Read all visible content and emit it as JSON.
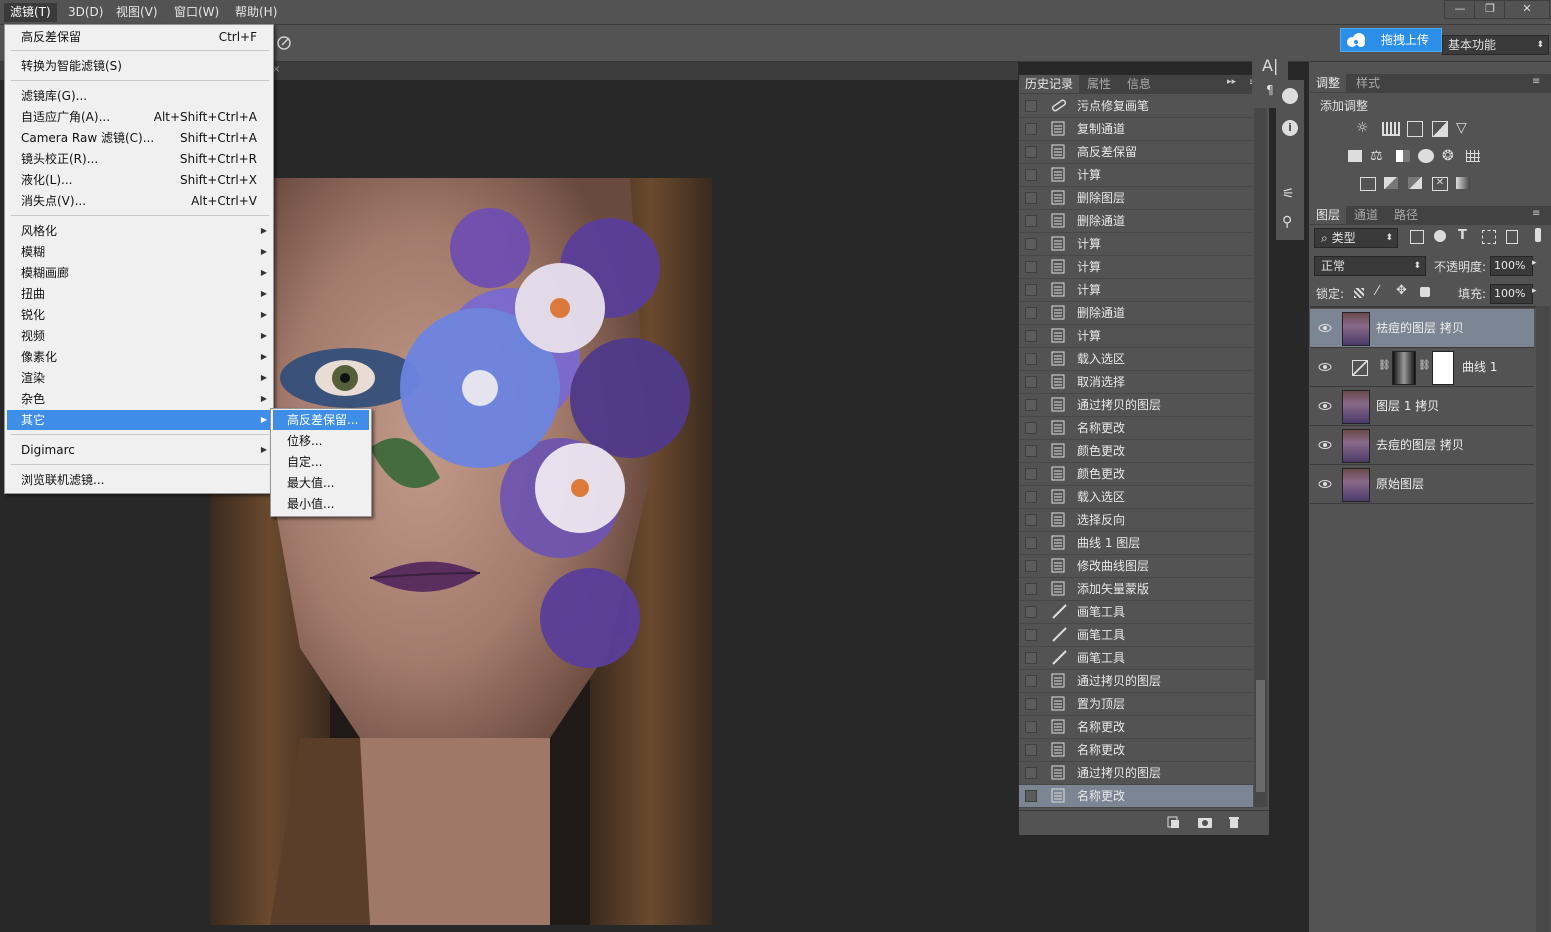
{
  "menubar": {
    "items": [
      "滤镜(T)",
      "3D(D)",
      "视图(V)",
      "窗口(W)",
      "帮助(H)"
    ],
    "window_buttons": [
      "—",
      "❐",
      "✕"
    ]
  },
  "optbar": {
    "upload_label": "拖拽上传",
    "workspace": "基本功能"
  },
  "filter_menu": {
    "last_filter": {
      "label": "高反差保留",
      "shortcut": "Ctrl+F"
    },
    "convert_smart": "转换为智能滤镜(S)",
    "group2": [
      {
        "label": "滤镜库(G)...",
        "shortcut": ""
      },
      {
        "label": "自适应广角(A)...",
        "shortcut": "Alt+Shift+Ctrl+A"
      },
      {
        "label": "Camera Raw 滤镜(C)...",
        "shortcut": "Shift+Ctrl+A"
      },
      {
        "label": "镜头校正(R)...",
        "shortcut": "Shift+Ctrl+R"
      },
      {
        "label": "液化(L)...",
        "shortcut": "Shift+Ctrl+X"
      },
      {
        "label": "消失点(V)...",
        "shortcut": "Alt+Ctrl+V"
      }
    ],
    "submenus": [
      "风格化",
      "模糊",
      "模糊画廊",
      "扭曲",
      "锐化",
      "视频",
      "像素化",
      "渲染",
      "杂色",
      "其它"
    ],
    "digimarc": "Digimarc",
    "browse_online": "浏览联机滤镜..."
  },
  "other_submenu": [
    "高反差保留...",
    "位移...",
    "自定...",
    "最大值...",
    "最小值..."
  ],
  "history_panel": {
    "tabs": [
      "历史记录",
      "属性",
      "信息"
    ],
    "items": [
      {
        "label": "污点修复画笔",
        "icon": "healing-brush-icon"
      },
      {
        "label": "复制通道",
        "icon": "document-icon"
      },
      {
        "label": "高反差保留",
        "icon": "document-icon"
      },
      {
        "label": "计算",
        "icon": "document-icon"
      },
      {
        "label": "删除图层",
        "icon": "document-icon"
      },
      {
        "label": "删除通道",
        "icon": "document-icon"
      },
      {
        "label": "计算",
        "icon": "document-icon"
      },
      {
        "label": "计算",
        "icon": "document-icon"
      },
      {
        "label": "计算",
        "icon": "document-icon"
      },
      {
        "label": "删除通道",
        "icon": "document-icon"
      },
      {
        "label": "计算",
        "icon": "document-icon"
      },
      {
        "label": "载入选区",
        "icon": "document-icon"
      },
      {
        "label": "取消选择",
        "icon": "document-icon"
      },
      {
        "label": "通过拷贝的图层",
        "icon": "document-icon"
      },
      {
        "label": "名称更改",
        "icon": "document-icon"
      },
      {
        "label": "颜色更改",
        "icon": "document-icon"
      },
      {
        "label": "颜色更改",
        "icon": "document-icon"
      },
      {
        "label": "载入选区",
        "icon": "document-icon"
      },
      {
        "label": "选择反向",
        "icon": "document-icon"
      },
      {
        "label": "曲线 1 图层",
        "icon": "document-icon"
      },
      {
        "label": "修改曲线图层",
        "icon": "document-icon"
      },
      {
        "label": "添加矢量蒙版",
        "icon": "document-icon"
      },
      {
        "label": "画笔工具",
        "icon": "brush-icon"
      },
      {
        "label": "画笔工具",
        "icon": "brush-icon"
      },
      {
        "label": "画笔工具",
        "icon": "brush-icon"
      },
      {
        "label": "通过拷贝的图层",
        "icon": "document-icon"
      },
      {
        "label": "置为顶层",
        "icon": "document-icon"
      },
      {
        "label": "名称更改",
        "icon": "document-icon"
      },
      {
        "label": "名称更改",
        "icon": "document-icon"
      },
      {
        "label": "通过拷贝的图层",
        "icon": "document-icon"
      },
      {
        "label": "名称更改",
        "icon": "document-icon"
      }
    ]
  },
  "adjustments_panel": {
    "tabs": [
      "调整",
      "样式"
    ],
    "title": "添加调整"
  },
  "layers_panel": {
    "tabs": [
      "图层",
      "通道",
      "路径"
    ],
    "filter_kind": "类型",
    "blend_mode": "正常",
    "opacity_label": "不透明度:",
    "opacity": "100%",
    "lock_label": "锁定:",
    "fill_label": "填充:",
    "fill": "100%",
    "layers": [
      "祛痘的图层 拷贝",
      "曲线 1",
      "图层 1 拷贝",
      "去痘的图层 拷贝",
      "原始图层"
    ]
  }
}
